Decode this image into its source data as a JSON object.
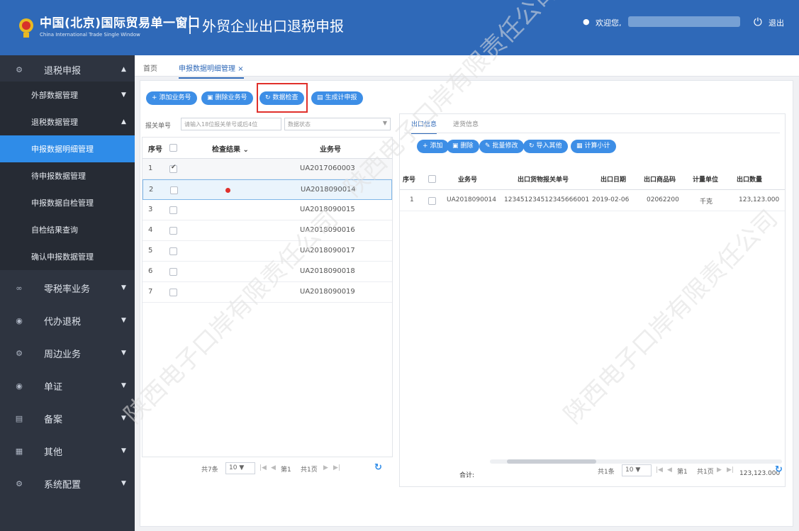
{
  "header": {
    "brand_cn": "中国(北京)国际贸易单一窗口",
    "brand_en": "China International Trade Single Window",
    "system_title": "外贸企业出口退税申报",
    "welcome": "欢迎您,",
    "logout": "退出"
  },
  "sidebar": {
    "main": [
      {
        "label": "退税申报",
        "icon": "gear-icon"
      },
      {
        "label": "零税率业务",
        "icon": "link-icon"
      },
      {
        "label": "代办退税",
        "icon": "stack-icon"
      },
      {
        "label": "周边业务",
        "icon": "gear-icon"
      },
      {
        "label": "单证",
        "icon": "stack-icon"
      },
      {
        "label": "备案",
        "icon": "book-icon"
      },
      {
        "label": "其他",
        "icon": "grid-icon"
      },
      {
        "label": "系统配置",
        "icon": "gear-icon"
      }
    ],
    "sub": [
      {
        "label": "外部数据管理"
      },
      {
        "label": "退税数据管理"
      },
      {
        "label": "申报数据明细管理"
      },
      {
        "label": "待申报数据管理"
      },
      {
        "label": "申报数据自检管理"
      },
      {
        "label": "自检结果查询"
      },
      {
        "label": "确认申报数据管理"
      }
    ]
  },
  "tabs": {
    "home": "首页",
    "active": "申报数据明细管理"
  },
  "toolbar": {
    "add": "添加业务号",
    "delete": "删除业务号",
    "check": "数据检查",
    "generate": "生成计申报"
  },
  "filter": {
    "label": "报关单号",
    "placeholder": "请输入18位报关单号或后4位",
    "status_placeholder": "数据状态"
  },
  "left_table": {
    "headers": {
      "seq": "序号",
      "result": "检查结果",
      "biz": "业务号"
    },
    "rows": [
      {
        "seq": "1",
        "biz": "UA2017060003"
      },
      {
        "seq": "2",
        "biz": "UA2018090014"
      },
      {
        "seq": "3",
        "biz": "UA2018090015"
      },
      {
        "seq": "4",
        "biz": "UA2018090016"
      },
      {
        "seq": "5",
        "biz": "UA2018090017"
      },
      {
        "seq": "6",
        "biz": "UA2018090018"
      },
      {
        "seq": "7",
        "biz": "UA2018090019"
      }
    ],
    "pager": {
      "total": "共7条",
      "size": "10",
      "page_label": "第1",
      "pages": "共1页"
    }
  },
  "right_panel": {
    "tabs": [
      "出口信息",
      "进货信息"
    ],
    "toolbar": {
      "add": "添加",
      "delete": "删除",
      "batch": "批量修改",
      "import": "导入其他",
      "calc": "计算小计"
    },
    "headers": [
      "序号",
      "业务号",
      "出口货物报关单号",
      "出口日期",
      "出口商品码",
      "计量单位",
      "出口数量"
    ],
    "row": [
      "1",
      "UA2018090014",
      "123451234512345666001",
      "2019-02-06",
      "02062200",
      "千克",
      "123,123.000"
    ],
    "total_label": "合计:",
    "total_value": "123,123.000",
    "pager": {
      "total": "共1条",
      "size": "10",
      "page_label": "第1",
      "pages": "共1页"
    }
  },
  "watermark": "陕西电子口岸有限责任公司",
  "colors": {
    "header": "#2f69b8",
    "sidebar": "#2e3440",
    "active": "#2f8ce8",
    "button": "#3d8ee6",
    "highlight": "#e0302b"
  }
}
